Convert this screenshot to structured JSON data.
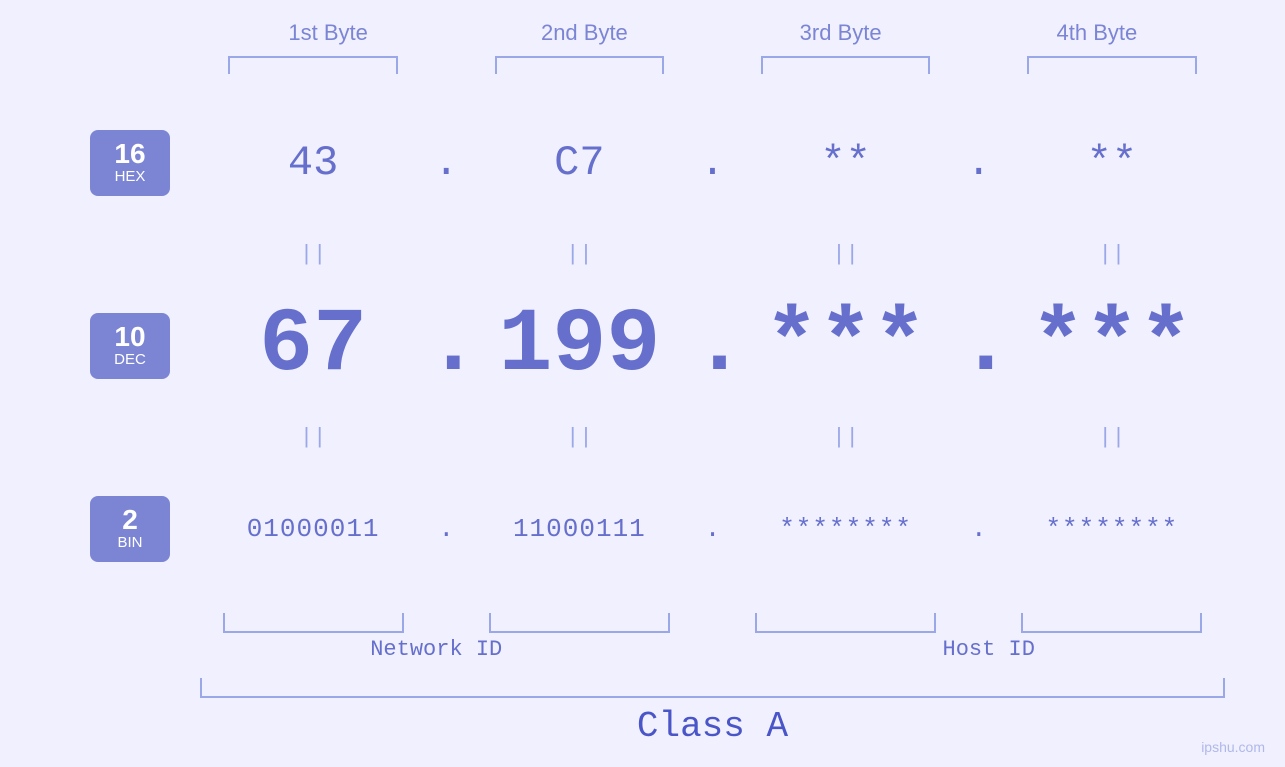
{
  "headers": {
    "byte1": "1st Byte",
    "byte2": "2nd Byte",
    "byte3": "3rd Byte",
    "byte4": "4th Byte"
  },
  "labels": {
    "hex_base": "16",
    "hex_name": "HEX",
    "dec_base": "10",
    "dec_name": "DEC",
    "bin_base": "2",
    "bin_name": "BIN"
  },
  "hex_row": {
    "val1": "43",
    "val2": "C7",
    "val3": "**",
    "val4": "**",
    "dot": "."
  },
  "dec_row": {
    "val1": "67",
    "val2": "199",
    "val3": "***",
    "val4": "***",
    "dot": "."
  },
  "bin_row": {
    "val1": "01000011",
    "val2": "11000111",
    "val3": "********",
    "val4": "********",
    "dot": "."
  },
  "equals": "||",
  "network_id_label": "Network ID",
  "host_id_label": "Host ID",
  "class_label": "Class A",
  "watermark": "ipshu.com"
}
